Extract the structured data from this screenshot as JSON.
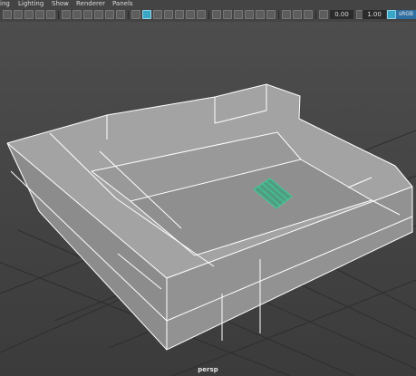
{
  "menubar": {
    "items": [
      "ing",
      "Lighting",
      "Show",
      "Renderer",
      "Panels"
    ]
  },
  "toolbar": {
    "field1": "0.00",
    "field2": "1.00",
    "color_space": "sRGB"
  },
  "viewport": {
    "camera": "persp",
    "colors": {
      "background_top": "#4d4d4d",
      "background_bottom": "#3b3b3b",
      "grid": "#2e2e2e",
      "mesh_top": "#a2a2a2",
      "mesh_side": "#8e8e8e",
      "wire": "#ffffff",
      "selected": "#3fcf99"
    }
  }
}
